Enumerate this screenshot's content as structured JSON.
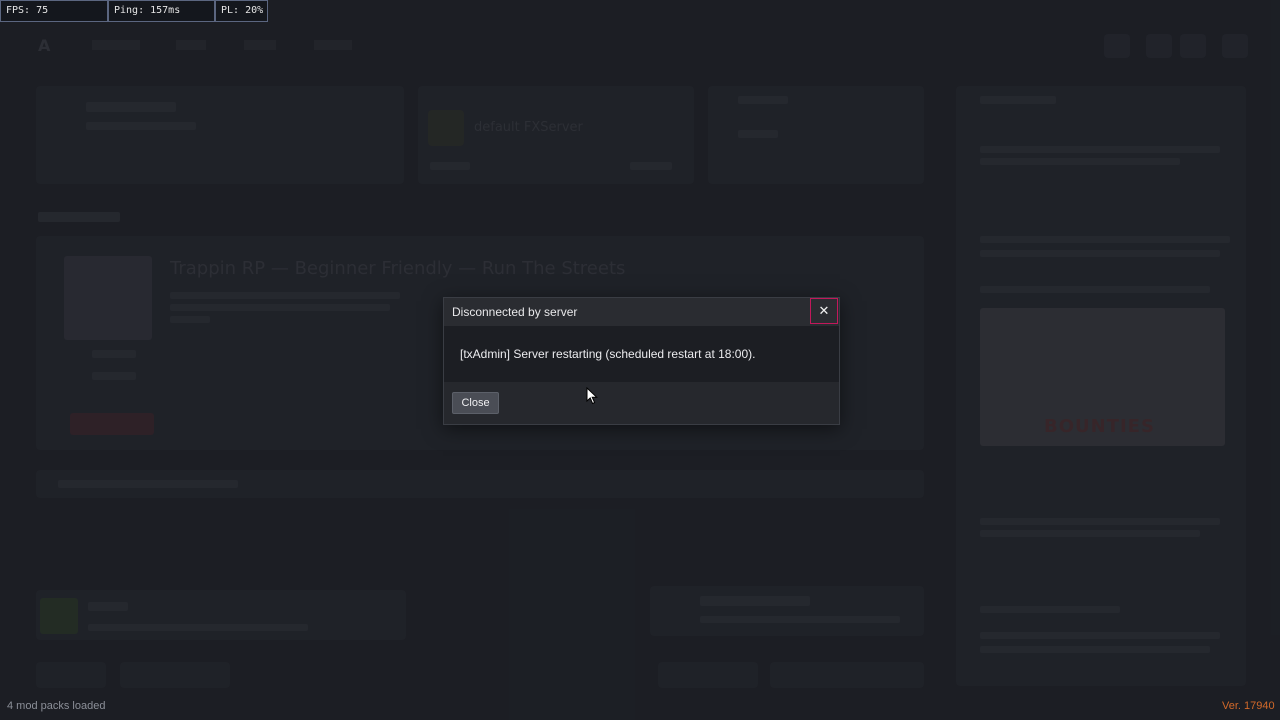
{
  "perf": {
    "fps": "FPS: 75",
    "ping": "Ping: 157ms",
    "pl": "PL: 20%"
  },
  "background": {
    "server_title": "Trappin RP — Beginner Friendly — Run The Streets",
    "fx_server_name": "default FXServer"
  },
  "dialog": {
    "title": "Disconnected by server",
    "close_icon": "close-icon",
    "message": "[txAdmin] Server restarting (scheduled restart at 18:00).",
    "close_button_label": "Close"
  },
  "footer": {
    "mod_packs": "4 mod packs loaded",
    "version": "Ver. 17940"
  },
  "colors": {
    "close_border": "#c2185b",
    "version_text": "#d2692a"
  }
}
